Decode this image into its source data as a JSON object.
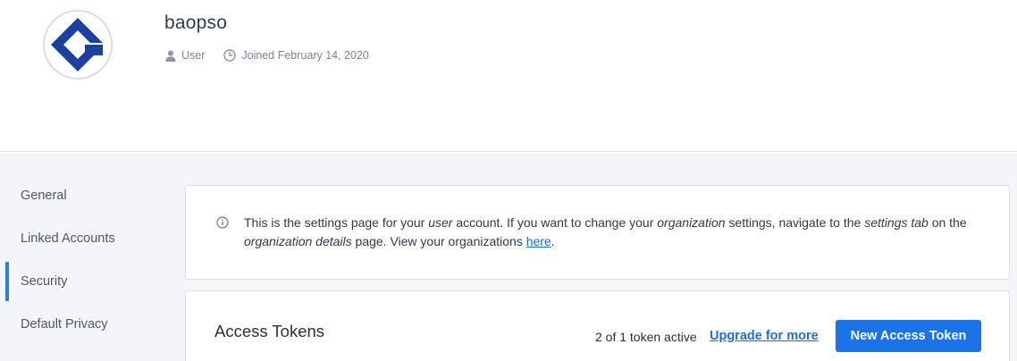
{
  "profile": {
    "username": "baopso",
    "role": "User",
    "joined": "Joined February 14, 2020",
    "logo_color": "#1c3fa0"
  },
  "sidebar": {
    "items": [
      {
        "label": "General",
        "active": false
      },
      {
        "label": "Linked Accounts",
        "active": false
      },
      {
        "label": "Security",
        "active": true
      },
      {
        "label": "Default Privacy",
        "active": false
      }
    ]
  },
  "notice": {
    "t1": "This is the settings page for your ",
    "user": "user",
    "t2": " account. If you want to change your ",
    "organization": "organization",
    "t3": " settings, navigate to the ",
    "settings_tab": "settings tab",
    "t4": " on the ",
    "organization_details": "organization details",
    "t5": " page. View your organizations ",
    "link": "here",
    "t6": "."
  },
  "tokens": {
    "title": "Access Tokens",
    "count": "2 of 1 token active",
    "upgrade": "Upgrade for more",
    "new_button": "New Access Token"
  },
  "colors": {
    "accent": "#1b73e8",
    "link": "#1e6ed9",
    "active_indicator": "#2b7fd9"
  }
}
